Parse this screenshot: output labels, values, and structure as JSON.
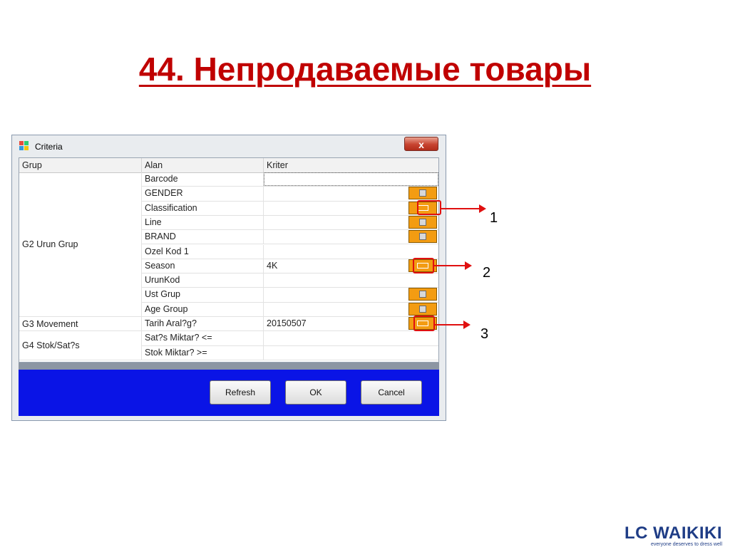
{
  "slide": {
    "title": "44. Непродаваемые товары"
  },
  "dialog": {
    "title": "Criteria",
    "close_label": "x",
    "columns": [
      "Grup",
      "Alan",
      "Kriter"
    ],
    "groups": [
      {
        "label": "G2 Urun Grup"
      },
      {
        "label": "G3 Movement"
      },
      {
        "label": "G4 Stok/Sat?s"
      }
    ],
    "rows": [
      {
        "alan": "Barcode",
        "kriter": "",
        "picker": false
      },
      {
        "alan": "GENDER",
        "kriter": "",
        "picker": true
      },
      {
        "alan": "Classification",
        "kriter": "",
        "picker": true
      },
      {
        "alan": "Line",
        "kriter": "",
        "picker": true
      },
      {
        "alan": "BRAND",
        "kriter": "",
        "picker": true
      },
      {
        "alan": "Ozel Kod 1",
        "kriter": "",
        "picker": false
      },
      {
        "alan": "Season",
        "kriter": "4K",
        "picker": true
      },
      {
        "alan": "UrunKod",
        "kriter": "",
        "picker": false
      },
      {
        "alan": "Ust Grup",
        "kriter": "",
        "picker": true
      },
      {
        "alan": "Age Group",
        "kriter": "",
        "picker": true
      },
      {
        "alan": "Tarih Aral?g?",
        "kriter": "20150507",
        "picker": true
      },
      {
        "alan": "Sat?s Miktar? <=",
        "kriter": "",
        "picker": false
      },
      {
        "alan": "Stok Miktar? >=",
        "kriter": "",
        "picker": false
      }
    ],
    "buttons": {
      "refresh": "Refresh",
      "ok": "OK",
      "cancel": "Cancel"
    }
  },
  "callouts": [
    "1",
    "2",
    "3"
  ],
  "logo": {
    "main": "LC WAIKIKI",
    "tagline": "everyone deserves to dress well"
  },
  "colors": {
    "title": "#c00000",
    "picker": "#f39c12",
    "footer": "#0a14e6",
    "callout": "#e01010"
  }
}
